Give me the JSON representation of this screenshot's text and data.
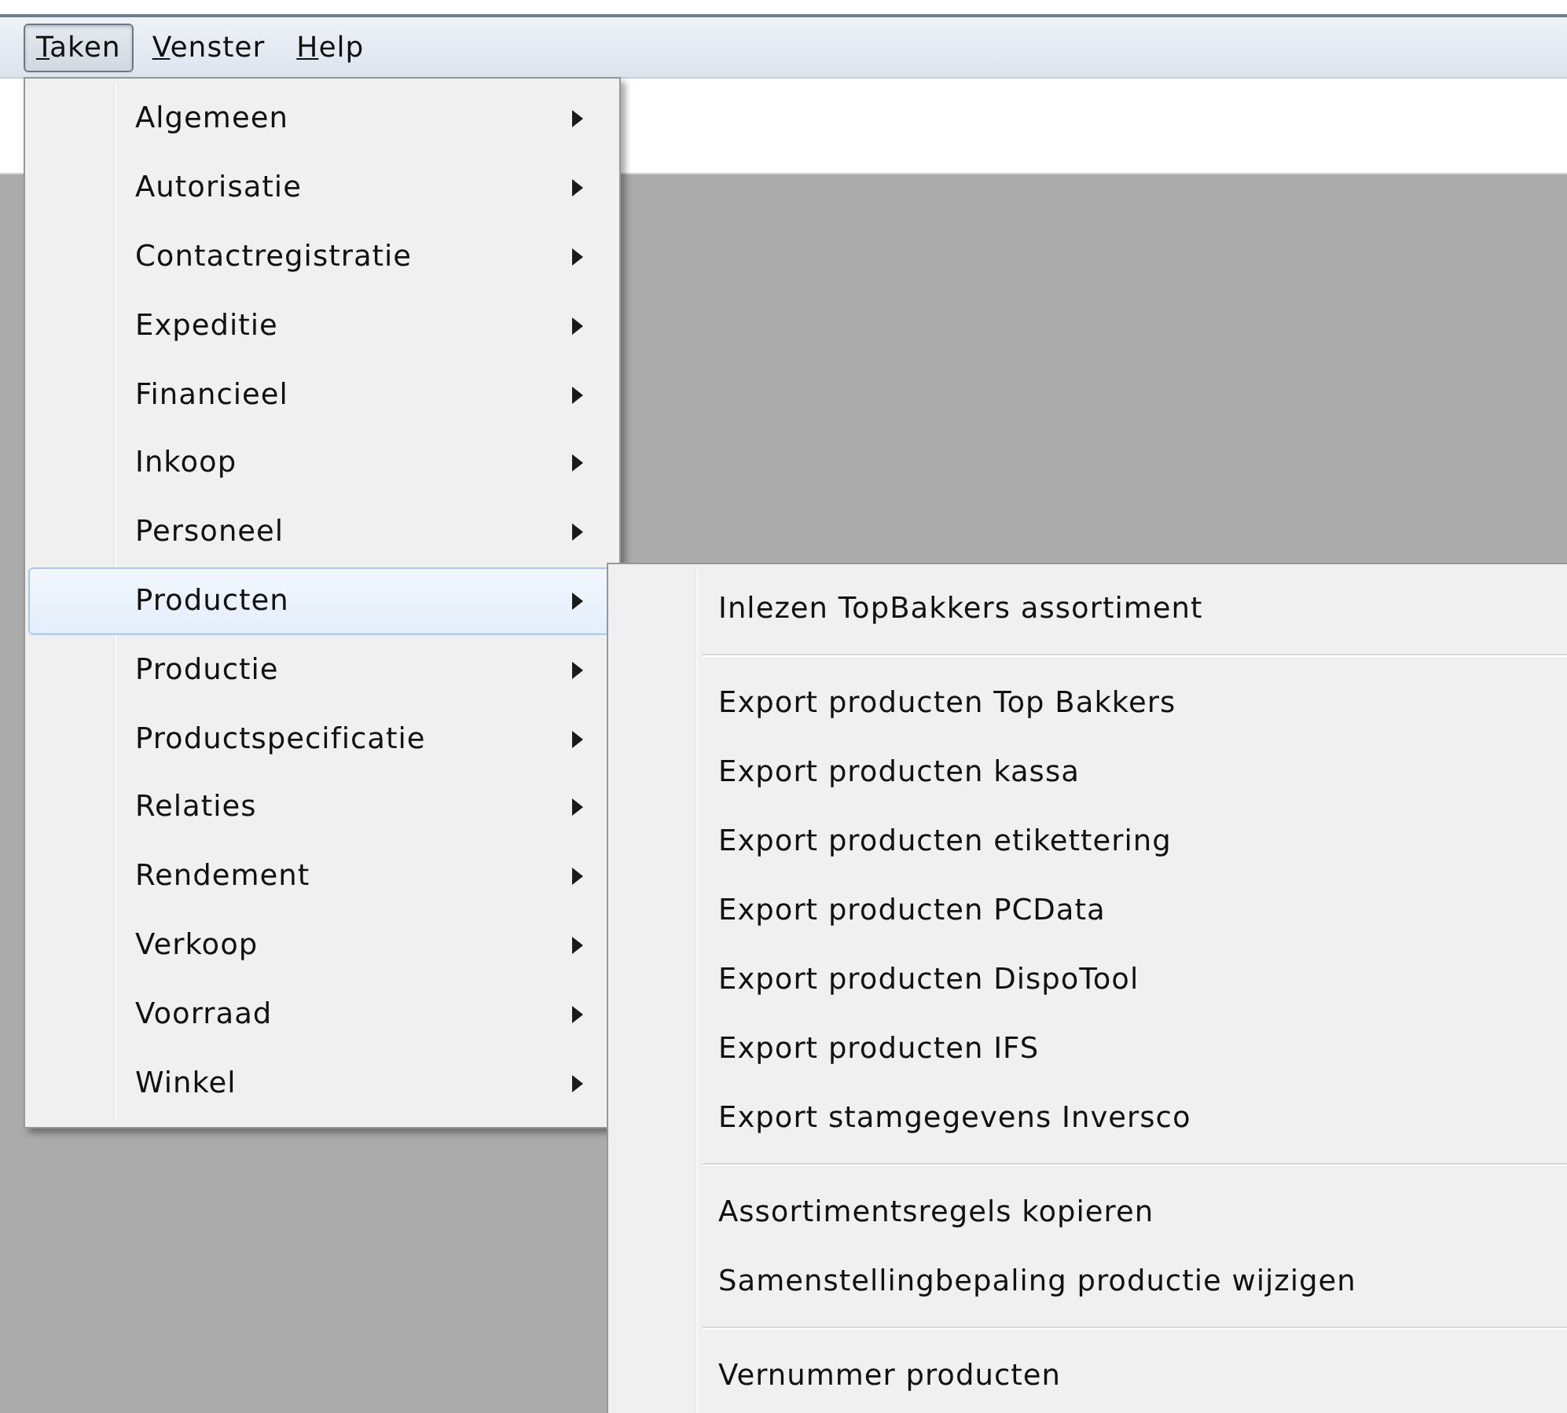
{
  "menu_bar": [
    {
      "mnemonic": "T",
      "rest": "aken",
      "selected": true
    },
    {
      "mnemonic": "V",
      "rest": "enster",
      "selected": false
    },
    {
      "mnemonic": "H",
      "rest": "elp",
      "selected": false
    }
  ],
  "menu": {
    "items": [
      {
        "label": "Algemeen",
        "has_submenu": true,
        "selected": false
      },
      {
        "label": "Autorisatie",
        "has_submenu": true,
        "selected": false
      },
      {
        "label": "Contactregistratie",
        "has_submenu": true,
        "selected": false
      },
      {
        "label": "Expeditie",
        "has_submenu": true,
        "selected": false
      },
      {
        "label": "Financieel",
        "has_submenu": true,
        "selected": false
      },
      {
        "label": "Inkoop",
        "has_submenu": true,
        "selected": false
      },
      {
        "label": "Personeel",
        "has_submenu": true,
        "selected": false
      },
      {
        "label": "Producten",
        "has_submenu": true,
        "selected": true
      },
      {
        "label": "Productie",
        "has_submenu": true,
        "selected": false
      },
      {
        "label": "Productspecificatie",
        "has_submenu": true,
        "selected": false
      },
      {
        "label": "Relaties",
        "has_submenu": true,
        "selected": false
      },
      {
        "label": "Rendement",
        "has_submenu": true,
        "selected": false
      },
      {
        "label": "Verkoop",
        "has_submenu": true,
        "selected": false
      },
      {
        "label": "Voorraad",
        "has_submenu": true,
        "selected": false
      },
      {
        "label": "Winkel",
        "has_submenu": true,
        "selected": false
      }
    ]
  },
  "submenu": {
    "items": [
      {
        "kind": "item",
        "label": "Inlezen TopBakkers assortiment"
      },
      {
        "kind": "separator"
      },
      {
        "kind": "item",
        "label": "Export producten Top Bakkers"
      },
      {
        "kind": "item",
        "label": "Export producten kassa"
      },
      {
        "kind": "item",
        "label": "Export producten etikettering"
      },
      {
        "kind": "item",
        "label": "Export producten PCData"
      },
      {
        "kind": "item",
        "label": "Export producten DispoTool"
      },
      {
        "kind": "item",
        "label": "Export producten IFS"
      },
      {
        "kind": "item",
        "label": "Export stamgegevens Inversco"
      },
      {
        "kind": "separator"
      },
      {
        "kind": "item",
        "label": "Assortimentsregels kopieren"
      },
      {
        "kind": "item",
        "label": "Samenstellingbepaling productie wijzigen"
      },
      {
        "kind": "separator"
      },
      {
        "kind": "item",
        "label": "Vernummer producten"
      }
    ]
  }
}
